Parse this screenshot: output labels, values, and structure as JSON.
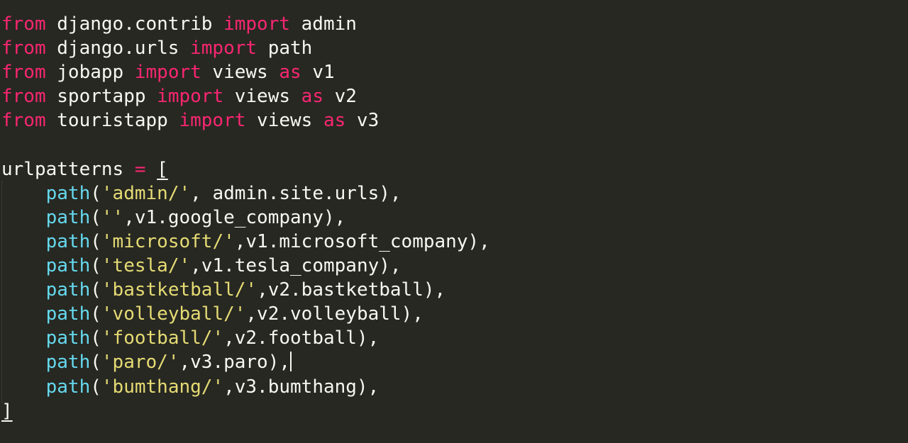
{
  "editor": {
    "lines": [
      {
        "tokens": [
          {
            "t": "from",
            "c": "kw"
          },
          {
            "t": " django.contrib ",
            "c": "plain"
          },
          {
            "t": "import",
            "c": "kw"
          },
          {
            "t": " admin",
            "c": "plain"
          }
        ]
      },
      {
        "tokens": [
          {
            "t": "from",
            "c": "kw"
          },
          {
            "t": " django.urls ",
            "c": "plain"
          },
          {
            "t": "import",
            "c": "kw"
          },
          {
            "t": " path",
            "c": "plain"
          }
        ]
      },
      {
        "tokens": [
          {
            "t": "from",
            "c": "kw"
          },
          {
            "t": " jobapp ",
            "c": "plain"
          },
          {
            "t": "import",
            "c": "kw"
          },
          {
            "t": " views ",
            "c": "plain"
          },
          {
            "t": "as",
            "c": "kw"
          },
          {
            "t": " v1",
            "c": "plain"
          }
        ]
      },
      {
        "tokens": [
          {
            "t": "from",
            "c": "kw"
          },
          {
            "t": " sportapp ",
            "c": "plain"
          },
          {
            "t": "import",
            "c": "kw"
          },
          {
            "t": " views ",
            "c": "plain"
          },
          {
            "t": "as",
            "c": "kw"
          },
          {
            "t": " v2",
            "c": "plain"
          }
        ]
      },
      {
        "tokens": [
          {
            "t": "from",
            "c": "kw"
          },
          {
            "t": " touristapp ",
            "c": "plain"
          },
          {
            "t": "import",
            "c": "kw"
          },
          {
            "t": " views ",
            "c": "plain"
          },
          {
            "t": "as",
            "c": "kw"
          },
          {
            "t": " v3",
            "c": "plain"
          }
        ]
      },
      {
        "tokens": []
      },
      {
        "tokens": [
          {
            "t": "urlpatterns ",
            "c": "plain"
          },
          {
            "t": "=",
            "c": "kw"
          },
          {
            "t": " ",
            "c": "plain"
          },
          {
            "t": "[",
            "c": "plain",
            "u": true
          }
        ]
      },
      {
        "tokens": [
          {
            "t": "    ",
            "c": "plain"
          },
          {
            "t": "path",
            "c": "fn"
          },
          {
            "t": "(",
            "c": "plain"
          },
          {
            "t": "'admin/'",
            "c": "str"
          },
          {
            "t": ", admin.site.urls),",
            "c": "plain"
          }
        ]
      },
      {
        "tokens": [
          {
            "t": "    ",
            "c": "plain"
          },
          {
            "t": "path",
            "c": "fn"
          },
          {
            "t": "(",
            "c": "plain"
          },
          {
            "t": "''",
            "c": "str"
          },
          {
            "t": ",v1.google_company),",
            "c": "plain"
          }
        ]
      },
      {
        "tokens": [
          {
            "t": "    ",
            "c": "plain"
          },
          {
            "t": "path",
            "c": "fn"
          },
          {
            "t": "(",
            "c": "plain"
          },
          {
            "t": "'microsoft/'",
            "c": "str"
          },
          {
            "t": ",v1.microsoft_company),",
            "c": "plain"
          }
        ]
      },
      {
        "tokens": [
          {
            "t": "    ",
            "c": "plain"
          },
          {
            "t": "path",
            "c": "fn"
          },
          {
            "t": "(",
            "c": "plain"
          },
          {
            "t": "'tesla/'",
            "c": "str"
          },
          {
            "t": ",v1.tesla_company),",
            "c": "plain"
          }
        ]
      },
      {
        "tokens": [
          {
            "t": "    ",
            "c": "plain"
          },
          {
            "t": "path",
            "c": "fn"
          },
          {
            "t": "(",
            "c": "plain"
          },
          {
            "t": "'bastketball/'",
            "c": "str"
          },
          {
            "t": ",v2.bastketball),",
            "c": "plain"
          }
        ]
      },
      {
        "tokens": [
          {
            "t": "    ",
            "c": "plain"
          },
          {
            "t": "path",
            "c": "fn"
          },
          {
            "t": "(",
            "c": "plain"
          },
          {
            "t": "'volleyball/'",
            "c": "str"
          },
          {
            "t": ",v2.volleyball),",
            "c": "plain"
          }
        ]
      },
      {
        "tokens": [
          {
            "t": "    ",
            "c": "plain"
          },
          {
            "t": "path",
            "c": "fn"
          },
          {
            "t": "(",
            "c": "plain"
          },
          {
            "t": "'football/'",
            "c": "str"
          },
          {
            "t": ",v2.football),",
            "c": "plain"
          }
        ]
      },
      {
        "tokens": [
          {
            "t": "    ",
            "c": "plain"
          },
          {
            "t": "path",
            "c": "fn"
          },
          {
            "t": "(",
            "c": "plain"
          },
          {
            "t": "'paro/'",
            "c": "str"
          },
          {
            "t": ",v3.paro),",
            "c": "plain"
          }
        ],
        "cursor": true
      },
      {
        "tokens": [
          {
            "t": "    ",
            "c": "plain"
          },
          {
            "t": "path",
            "c": "fn"
          },
          {
            "t": "(",
            "c": "plain"
          },
          {
            "t": "'bumthang/'",
            "c": "str"
          },
          {
            "t": ",v3.bumthang),",
            "c": "plain"
          }
        ]
      },
      {
        "tokens": [
          {
            "t": "]",
            "c": "plain",
            "u": true
          }
        ]
      }
    ]
  },
  "theme": {
    "background": "#272822",
    "keyword": "#f92672",
    "function": "#66d9ef",
    "string": "#e6db74",
    "text": "#f8f8f2"
  }
}
